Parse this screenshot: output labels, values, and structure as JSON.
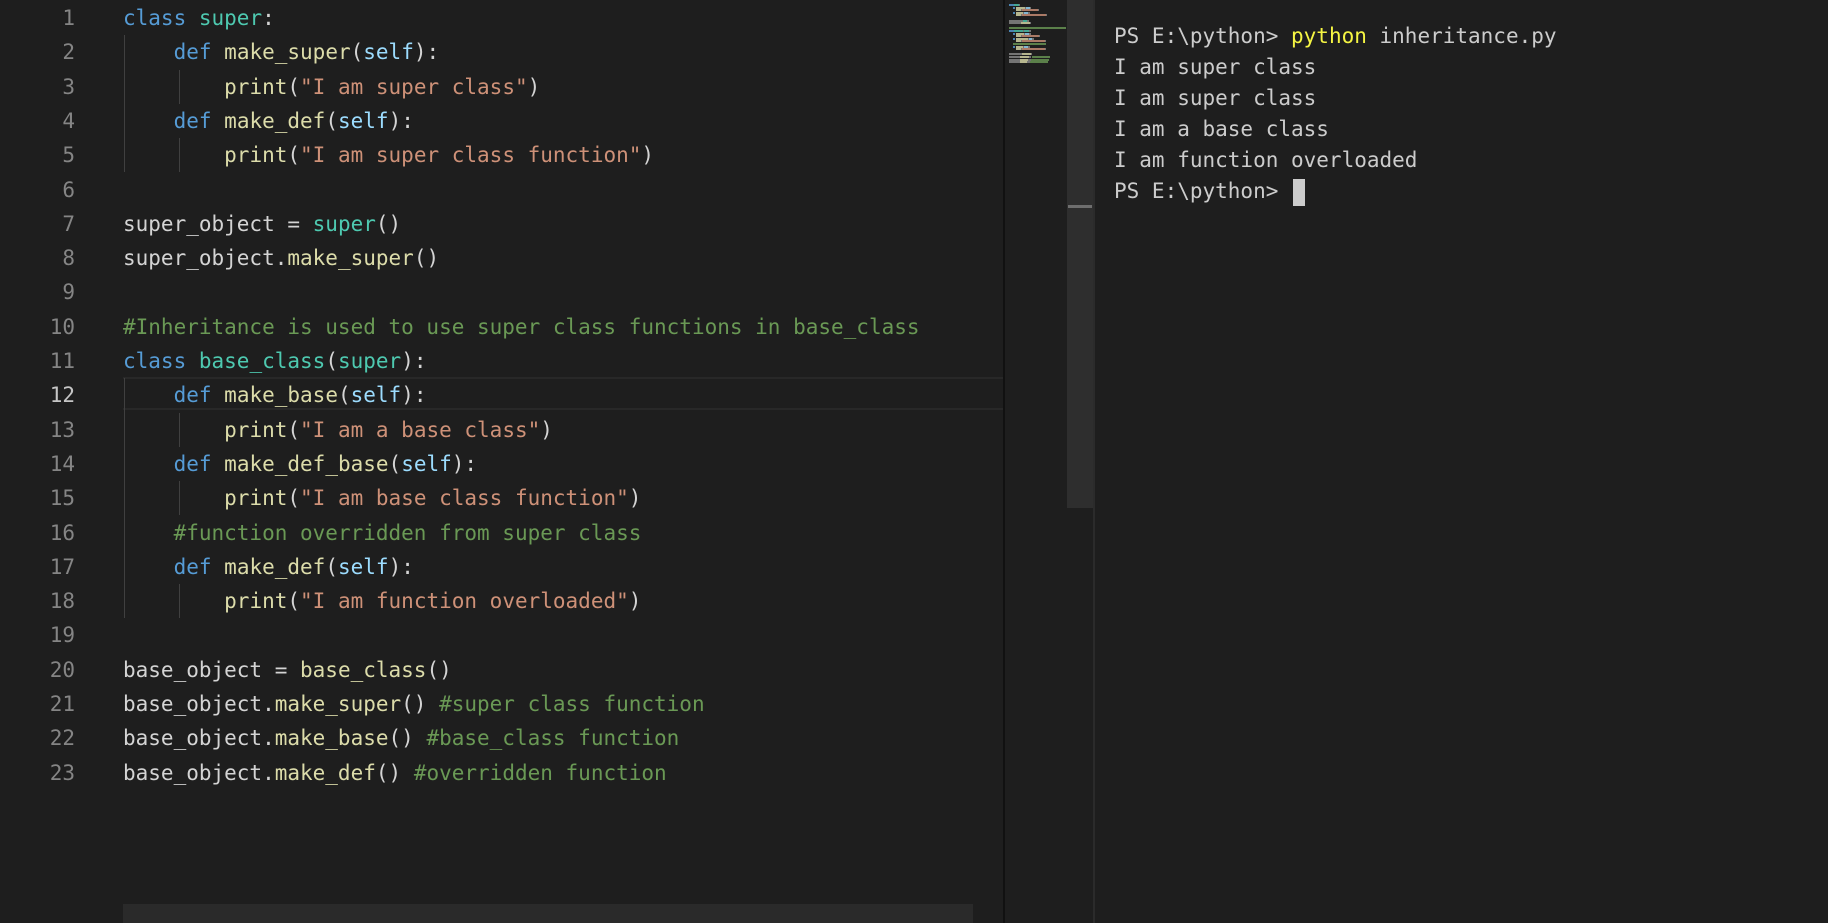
{
  "editor": {
    "active_line": 12,
    "line_numbers": [
      "1",
      "2",
      "3",
      "4",
      "5",
      "6",
      "7",
      "8",
      "9",
      "10",
      "11",
      "12",
      "13",
      "14",
      "15",
      "16",
      "17",
      "18",
      "19",
      "20",
      "21",
      "22",
      "23"
    ],
    "lines": [
      [
        {
          "t": "class",
          "c": "kw"
        },
        {
          "t": " "
        },
        {
          "t": "super",
          "c": "cls"
        },
        {
          "t": ":"
        }
      ],
      [
        {
          "t": "    "
        },
        {
          "t": "def",
          "c": "kw"
        },
        {
          "t": " "
        },
        {
          "t": "make_super",
          "c": "fn"
        },
        {
          "t": "("
        },
        {
          "t": "self",
          "c": "self"
        },
        {
          "t": "):"
        }
      ],
      [
        {
          "t": "        "
        },
        {
          "t": "print",
          "c": "fn"
        },
        {
          "t": "("
        },
        {
          "t": "\"I am super class\"",
          "c": "str"
        },
        {
          "t": ")"
        }
      ],
      [
        {
          "t": "    "
        },
        {
          "t": "def",
          "c": "kw"
        },
        {
          "t": " "
        },
        {
          "t": "make_def",
          "c": "fn"
        },
        {
          "t": "("
        },
        {
          "t": "self",
          "c": "self"
        },
        {
          "t": "):"
        }
      ],
      [
        {
          "t": "        "
        },
        {
          "t": "print",
          "c": "fn"
        },
        {
          "t": "("
        },
        {
          "t": "\"I am super class function\"",
          "c": "str"
        },
        {
          "t": ")"
        }
      ],
      [],
      [
        {
          "t": "super_object = "
        },
        {
          "t": "super",
          "c": "cls"
        },
        {
          "t": "()"
        }
      ],
      [
        {
          "t": "super_object."
        },
        {
          "t": "make_super",
          "c": "fn"
        },
        {
          "t": "()"
        }
      ],
      [],
      [
        {
          "t": "#Inheritance is used to use super class functions in base_class",
          "c": "cmt"
        }
      ],
      [
        {
          "t": "class",
          "c": "kw"
        },
        {
          "t": " "
        },
        {
          "t": "base_class",
          "c": "cls"
        },
        {
          "t": "("
        },
        {
          "t": "super",
          "c": "cls"
        },
        {
          "t": "):"
        }
      ],
      [
        {
          "t": "    "
        },
        {
          "t": "def",
          "c": "kw"
        },
        {
          "t": " "
        },
        {
          "t": "make_base",
          "c": "fn"
        },
        {
          "t": "("
        },
        {
          "t": "self",
          "c": "self"
        },
        {
          "t": "):"
        }
      ],
      [
        {
          "t": "        "
        },
        {
          "t": "print",
          "c": "fn"
        },
        {
          "t": "("
        },
        {
          "t": "\"I am a base class\"",
          "c": "str"
        },
        {
          "t": ")"
        }
      ],
      [
        {
          "t": "    "
        },
        {
          "t": "def",
          "c": "kw"
        },
        {
          "t": " "
        },
        {
          "t": "make_def_base",
          "c": "fn"
        },
        {
          "t": "("
        },
        {
          "t": "self",
          "c": "self"
        },
        {
          "t": "):"
        }
      ],
      [
        {
          "t": "        "
        },
        {
          "t": "print",
          "c": "fn"
        },
        {
          "t": "("
        },
        {
          "t": "\"I am base class function\"",
          "c": "str"
        },
        {
          "t": ")"
        }
      ],
      [
        {
          "t": "    "
        },
        {
          "t": "#function overridden from super class",
          "c": "cmt"
        }
      ],
      [
        {
          "t": "    "
        },
        {
          "t": "def",
          "c": "kw"
        },
        {
          "t": " "
        },
        {
          "t": "make_def",
          "c": "fn"
        },
        {
          "t": "("
        },
        {
          "t": "self",
          "c": "self"
        },
        {
          "t": "):"
        }
      ],
      [
        {
          "t": "        "
        },
        {
          "t": "print",
          "c": "fn"
        },
        {
          "t": "("
        },
        {
          "t": "\"I am function overloaded\"",
          "c": "str"
        },
        {
          "t": ")"
        }
      ],
      [],
      [
        {
          "t": "base_object = "
        },
        {
          "t": "base_class",
          "c": "fn"
        },
        {
          "t": "()"
        }
      ],
      [
        {
          "t": "base_object."
        },
        {
          "t": "make_super",
          "c": "fn"
        },
        {
          "t": "() "
        },
        {
          "t": "#super class function",
          "c": "cmt"
        }
      ],
      [
        {
          "t": "base_object."
        },
        {
          "t": "make_base",
          "c": "fn"
        },
        {
          "t": "() "
        },
        {
          "t": "#base_class function",
          "c": "cmt"
        }
      ],
      [
        {
          "t": "base_object."
        },
        {
          "t": "make_def",
          "c": "fn"
        },
        {
          "t": "() "
        },
        {
          "t": "#overridden function",
          "c": "cmt"
        }
      ]
    ]
  },
  "terminal": {
    "prompt": "PS E:\\python> ",
    "command_exe": "python",
    "command_args": " inheritance.py",
    "output": [
      "I am super class",
      "I am super class",
      "I am a base class",
      "I am function overloaded"
    ],
    "final_prompt": "PS E:\\python> "
  },
  "colors": {
    "background": "#1e1e1e",
    "keyword": "#569cd6",
    "class": "#4ec9b0",
    "function": "#dcdcaa",
    "self": "#9cdcfe",
    "string": "#ce9178",
    "comment": "#6a9955",
    "terminal_command": "#f5f543"
  }
}
